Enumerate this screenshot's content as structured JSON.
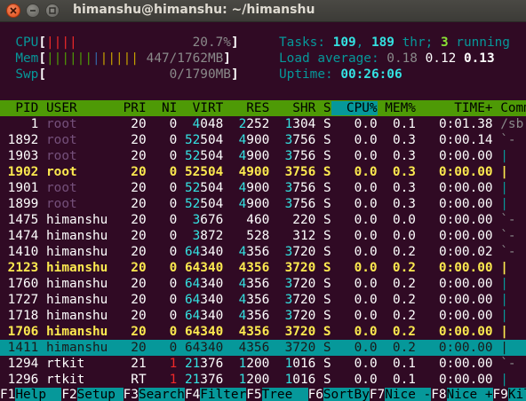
{
  "window": {
    "title": "himanshu@himanshu: ~/himanshu"
  },
  "meters": {
    "cpu_label": "CPU",
    "cpu_bar": "||||",
    "cpu_value": "20.7%",
    "mem_label": "Mem",
    "mem_bar_green": "||||||",
    "mem_bar_blue": "|",
    "mem_bar_yellow": "|||||",
    "mem_value": "447/1762MB",
    "swp_label": "Swp",
    "swp_value": "0/1790MB"
  },
  "summary": {
    "tasks_label": "Tasks: ",
    "tasks": "109",
    "threads": "189",
    "thr_label": " thr; ",
    "running": "3",
    "running_label": " running",
    "load_label": "Load average: ",
    "load1": "0.18",
    "load5": "0.12",
    "load15": "0.13",
    "uptime_label": "Uptime: ",
    "uptime": "00:26:06"
  },
  "table": {
    "columns": [
      "PID",
      "USER",
      "PRI",
      "NI",
      "VIRT",
      "RES",
      "SHR",
      "S",
      "CPU%",
      "MEM%",
      "TIME+",
      "Command"
    ],
    "rows": [
      {
        "pid": "1",
        "user": "root",
        "pri": "20",
        "ni": "0",
        "virt": "4048",
        "res": "2252",
        "shr": "1304",
        "s": "S",
        "cpu": "0.0",
        "mem": "0.1",
        "time": "0:01.38",
        "cmd": "/sb",
        "style": "normal"
      },
      {
        "pid": "1892",
        "user": "root",
        "pri": "20",
        "ni": "0",
        "virt": "52504",
        "res": "4900",
        "shr": "3756",
        "s": "S",
        "cpu": "0.0",
        "mem": "0.3",
        "time": "0:00.14",
        "cmd": "`-",
        "style": "normal"
      },
      {
        "pid": "1903",
        "user": "root",
        "pri": "20",
        "ni": "0",
        "virt": "52504",
        "res": "4900",
        "shr": "3756",
        "s": "S",
        "cpu": "0.0",
        "mem": "0.3",
        "time": "0:00.00",
        "cmd": "|",
        "style": "normal"
      },
      {
        "pid": "1902",
        "user": "root",
        "pri": "20",
        "ni": "0",
        "virt": "52504",
        "res": "4900",
        "shr": "3756",
        "s": "S",
        "cpu": "0.0",
        "mem": "0.3",
        "time": "0:00.00",
        "cmd": "|",
        "style": "bold"
      },
      {
        "pid": "1901",
        "user": "root",
        "pri": "20",
        "ni": "0",
        "virt": "52504",
        "res": "4900",
        "shr": "3756",
        "s": "S",
        "cpu": "0.0",
        "mem": "0.3",
        "time": "0:00.00",
        "cmd": "|",
        "style": "normal"
      },
      {
        "pid": "1899",
        "user": "root",
        "pri": "20",
        "ni": "0",
        "virt": "52504",
        "res": "4900",
        "shr": "3756",
        "s": "S",
        "cpu": "0.0",
        "mem": "0.3",
        "time": "0:00.00",
        "cmd": "|",
        "style": "normal"
      },
      {
        "pid": "1475",
        "user": "himanshu",
        "pri": "20",
        "ni": "0",
        "virt": "3676",
        "res": "460",
        "shr": "220",
        "s": "S",
        "cpu": "0.0",
        "mem": "0.0",
        "time": "0:00.00",
        "cmd": "`-",
        "style": "normal"
      },
      {
        "pid": "1474",
        "user": "himanshu",
        "pri": "20",
        "ni": "0",
        "virt": "3872",
        "res": "528",
        "shr": "312",
        "s": "S",
        "cpu": "0.0",
        "mem": "0.0",
        "time": "0:00.00",
        "cmd": "`-",
        "style": "normal"
      },
      {
        "pid": "1410",
        "user": "himanshu",
        "pri": "20",
        "ni": "0",
        "virt": "64340",
        "res": "4356",
        "shr": "3720",
        "s": "S",
        "cpu": "0.0",
        "mem": "0.2",
        "time": "0:00.02",
        "cmd": "`-",
        "style": "normal"
      },
      {
        "pid": "2123",
        "user": "himanshu",
        "pri": "20",
        "ni": "0",
        "virt": "64340",
        "res": "4356",
        "shr": "3720",
        "s": "S",
        "cpu": "0.0",
        "mem": "0.2",
        "time": "0:00.00",
        "cmd": "|",
        "style": "bold"
      },
      {
        "pid": "1760",
        "user": "himanshu",
        "pri": "20",
        "ni": "0",
        "virt": "64340",
        "res": "4356",
        "shr": "3720",
        "s": "S",
        "cpu": "0.0",
        "mem": "0.2",
        "time": "0:00.00",
        "cmd": "|",
        "style": "normal"
      },
      {
        "pid": "1727",
        "user": "himanshu",
        "pri": "20",
        "ni": "0",
        "virt": "64340",
        "res": "4356",
        "shr": "3720",
        "s": "S",
        "cpu": "0.0",
        "mem": "0.2",
        "time": "0:00.00",
        "cmd": "|",
        "style": "normal"
      },
      {
        "pid": "1718",
        "user": "himanshu",
        "pri": "20",
        "ni": "0",
        "virt": "64340",
        "res": "4356",
        "shr": "3720",
        "s": "S",
        "cpu": "0.0",
        "mem": "0.2",
        "time": "0:00.00",
        "cmd": "|",
        "style": "normal"
      },
      {
        "pid": "1706",
        "user": "himanshu",
        "pri": "20",
        "ni": "0",
        "virt": "64340",
        "res": "4356",
        "shr": "3720",
        "s": "S",
        "cpu": "0.0",
        "mem": "0.2",
        "time": "0:00.00",
        "cmd": "|",
        "style": "bold"
      },
      {
        "pid": "1411",
        "user": "himanshu",
        "pri": "20",
        "ni": "0",
        "virt": "64340",
        "res": "4356",
        "shr": "3720",
        "s": "S",
        "cpu": "0.0",
        "mem": "0.2",
        "time": "0:00.00",
        "cmd": "|",
        "style": "selected"
      },
      {
        "pid": "1294",
        "user": "rtkit",
        "pri": "21",
        "ni": "1",
        "virt": "21376",
        "res": "1200",
        "shr": "1016",
        "s": "S",
        "cpu": "0.0",
        "mem": "0.1",
        "time": "0:00.00",
        "cmd": "`-",
        "style": "normal"
      },
      {
        "pid": "1296",
        "user": "rtkit",
        "pri": "RT",
        "ni": "1",
        "virt": "21376",
        "res": "1200",
        "shr": "1016",
        "s": "S",
        "cpu": "0.0",
        "mem": "0.1",
        "time": "0:00.00",
        "cmd": "|",
        "style": "normal"
      }
    ]
  },
  "footer": {
    "keys": [
      {
        "key": "F1",
        "label": "Help  "
      },
      {
        "key": "F2",
        "label": "Setup "
      },
      {
        "key": "F3",
        "label": "Search"
      },
      {
        "key": "F4",
        "label": "Filter"
      },
      {
        "key": "F5",
        "label": "Tree  "
      },
      {
        "key": "F6",
        "label": "SortBy"
      },
      {
        "key": "F7",
        "label": "Nice -"
      },
      {
        "key": "F8",
        "label": "Nice +"
      },
      {
        "key": "F9",
        "label": "Kill"
      }
    ]
  },
  "colors": {
    "terminal_bg": "#300a24",
    "header_bg": "#4e9a06",
    "selection_bg": "#06989a",
    "accent_cyan": "#34e2e2",
    "highlight_yellow": "#fce94f"
  }
}
